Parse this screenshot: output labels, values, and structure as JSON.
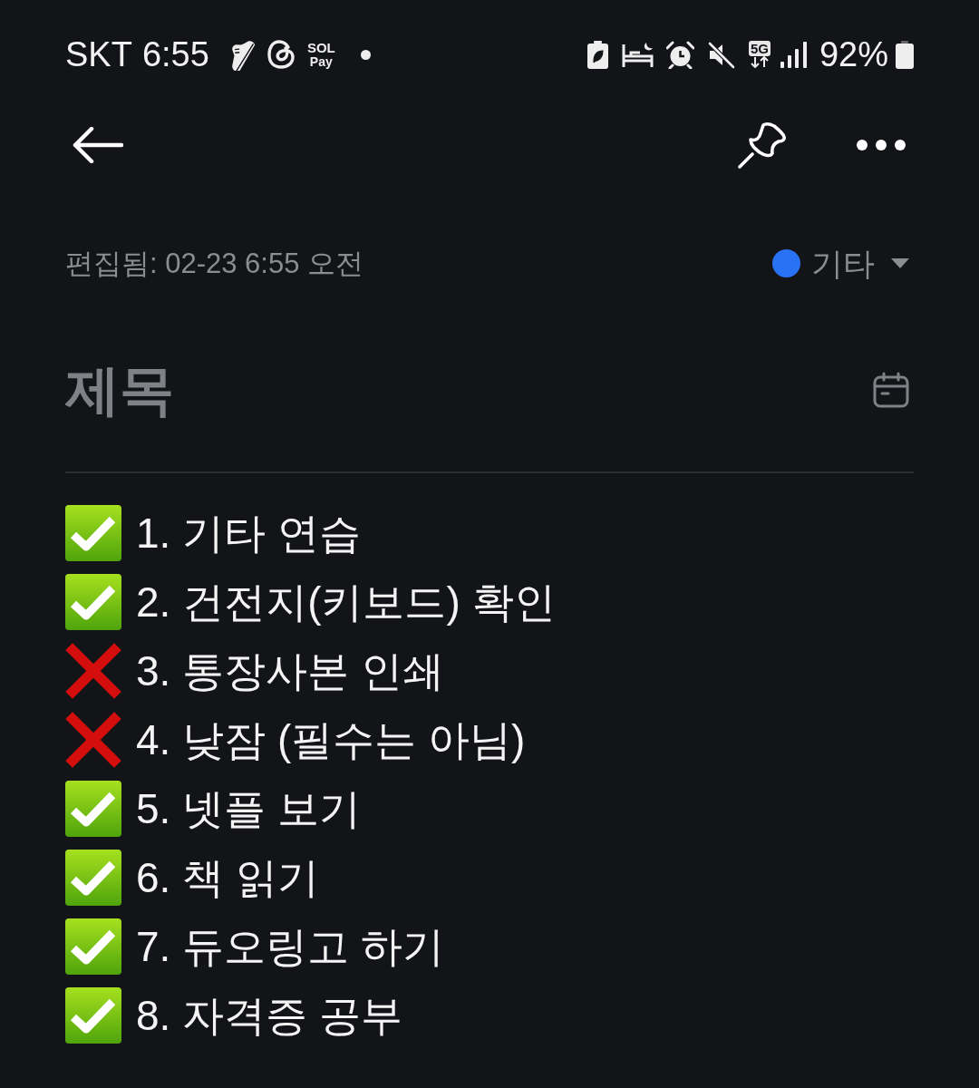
{
  "status_bar": {
    "carrier": "SKT",
    "time": "6:55",
    "app_label_top": "SOL",
    "app_label_bottom": "Pay",
    "network": "5G",
    "battery": "92%"
  },
  "note": {
    "edited": "편집됨: 02-23 6:55 오전",
    "category": {
      "label": "기타",
      "color": "#2a72f5"
    },
    "title": {
      "placeholder": "제목"
    },
    "items": [
      {
        "text": "1. 기타 연습",
        "checked": true
      },
      {
        "text": "2. 건전지(키보드) 확인",
        "checked": true
      },
      {
        "text": "3. 통장사본 인쇄",
        "checked": false
      },
      {
        "text": "4. 낮잠 (필수는 아님)",
        "checked": false
      },
      {
        "text": "5. 넷플 보기",
        "checked": true
      },
      {
        "text": "6. 책 읽기",
        "checked": true
      },
      {
        "text": "7. 듀오링고 하기",
        "checked": true
      },
      {
        "text": "8. 자격증 공부",
        "checked": true
      }
    ]
  }
}
